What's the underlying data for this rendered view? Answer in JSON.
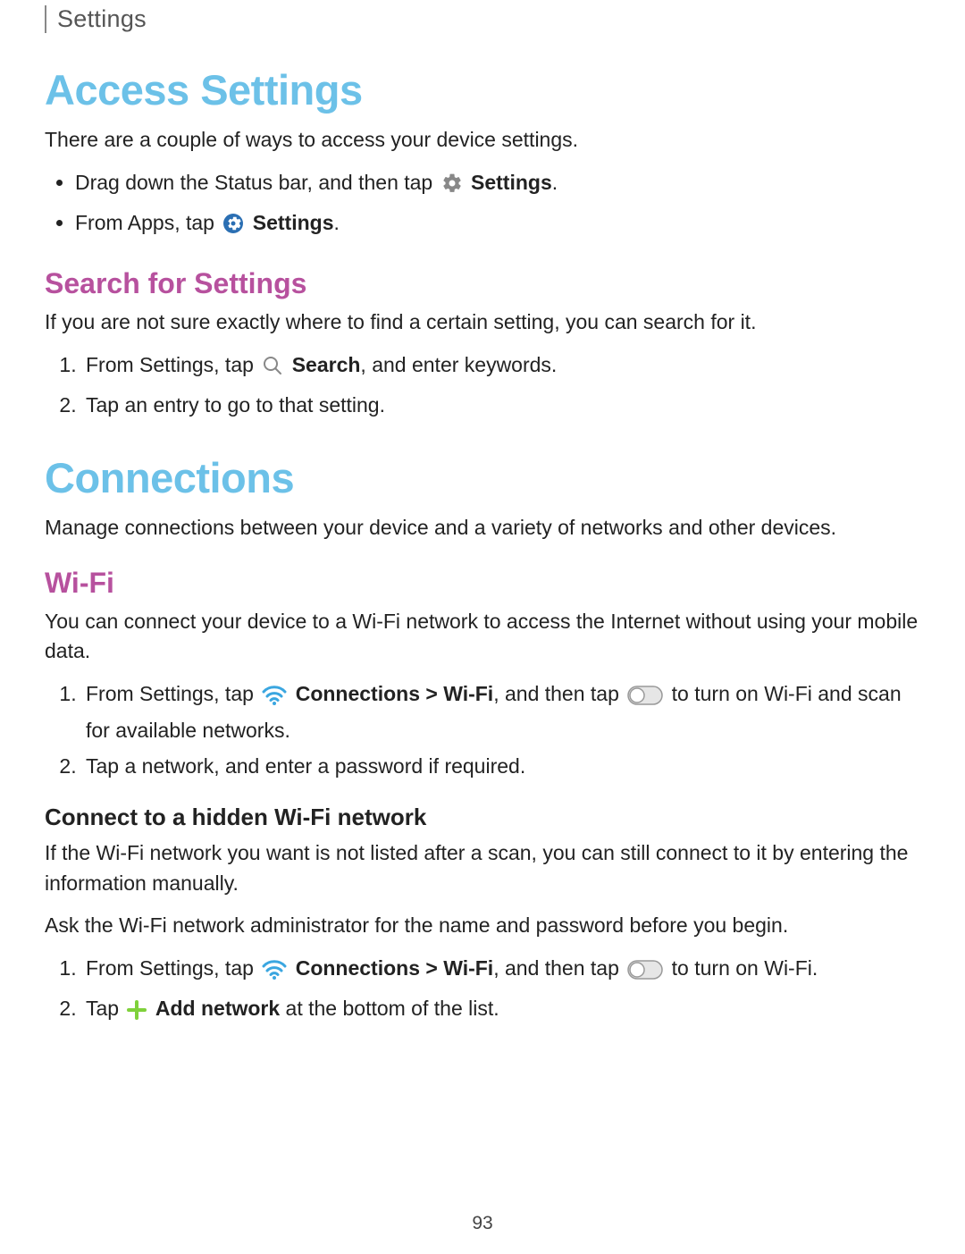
{
  "header": {
    "breadcrumb": "Settings"
  },
  "section1": {
    "title": "Access Settings",
    "intro": "There are a couple of ways to access your device settings.",
    "bullet1a": "Drag down the Status bar, and then tap ",
    "bullet1b": "Settings",
    "bullet1c": ".",
    "bullet2a": "From Apps, tap ",
    "bullet2b": "Settings",
    "bullet2c": "."
  },
  "search": {
    "title": "Search for Settings",
    "intro": "If you are not sure exactly where to find a certain setting, you can search for it.",
    "step1a": "From Settings, tap ",
    "step1b": "Search",
    "step1c": ", and enter keywords.",
    "step2": "Tap an entry to go to that setting."
  },
  "connections": {
    "title": "Connections",
    "intro": "Manage connections between your device and a variety of networks and other devices."
  },
  "wifi": {
    "title": "Wi-Fi",
    "intro": "You can connect your device to a Wi-Fi network to access the Internet without using your mobile data.",
    "step1a": "From Settings, tap ",
    "step1b": "Connections > Wi-Fi",
    "step1c": ", and then tap ",
    "step1d": " to turn on Wi-Fi and scan for available networks.",
    "step2": "Tap a network, and enter a password if required."
  },
  "hidden": {
    "title": "Connect to a hidden Wi-Fi network",
    "intro": "If the Wi-Fi network you want is not listed after a scan, you can still connect to it by entering the information manually.",
    "note": "Ask the Wi-Fi network administrator for the name and password before you begin.",
    "step1a": "From Settings, tap ",
    "step1b": "Connections > Wi-Fi",
    "step1c": ", and then tap ",
    "step1d": " to turn on Wi-Fi.",
    "step2a": "Tap ",
    "step2b": "Add network",
    "step2c": " at the bottom of the list."
  },
  "pageNumber": "93"
}
